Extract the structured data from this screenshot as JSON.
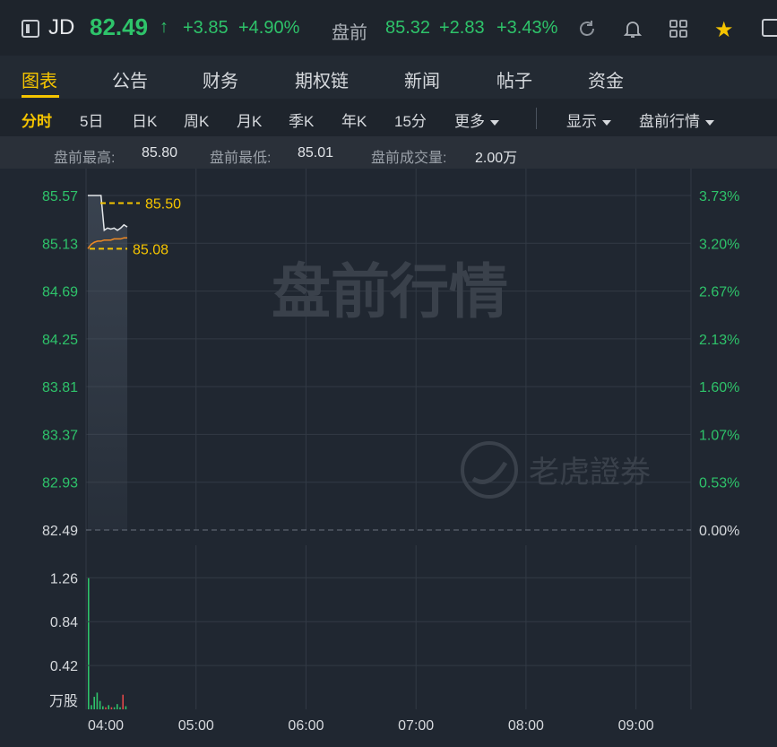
{
  "header": {
    "symbol": "JD",
    "price": "82.49",
    "arrow": "↑",
    "change": "+3.85",
    "change_pct": "+4.90%",
    "premarket_label": "盘前",
    "premarket_price": "85.32",
    "premarket_change": "+2.83",
    "premarket_change_pct": "+3.43%",
    "icons": [
      "refresh-icon",
      "bell-icon",
      "grid-icon",
      "star-icon",
      "window-icon"
    ],
    "colors": {
      "up": "#2ec36a",
      "accent": "#f5c400"
    }
  },
  "tabs": [
    {
      "label": "图表",
      "active": true
    },
    {
      "label": "公告"
    },
    {
      "label": "财务"
    },
    {
      "label": "期权链"
    },
    {
      "label": "新闻"
    },
    {
      "label": "帖子"
    },
    {
      "label": "资金"
    }
  ],
  "periods": {
    "items": [
      "分时",
      "5日",
      "日K",
      "周K",
      "月K",
      "季K",
      "年K",
      "15分"
    ],
    "active": "分时",
    "more": "更多",
    "display": "显示",
    "session": "盘前行情"
  },
  "stats": {
    "high_label": "盘前最高:",
    "high_value": "85.80",
    "low_label": "盘前最低:",
    "low_value": "85.01",
    "volume_label": "盘前成交量:",
    "volume_value": "2.00万"
  },
  "chart_data": {
    "type": "line",
    "watermark": "盘前行情",
    "brand_watermark": "老虎證券",
    "y_left_ticks": [
      "85.57",
      "85.13",
      "84.69",
      "84.25",
      "83.81",
      "83.37",
      "82.93",
      "82.49"
    ],
    "y_right_ticks": [
      "3.73%",
      "3.20%",
      "2.67%",
      "2.13%",
      "1.60%",
      "1.07%",
      "0.53%",
      "0.00%"
    ],
    "x_ticks": [
      "04:00",
      "05:00",
      "06:00",
      "07:00",
      "08:00",
      "09:00"
    ],
    "ylim": [
      82.49,
      85.57
    ],
    "marker_high": "85.50",
    "marker_low": "85.08",
    "price_series": [
      85.57,
      85.57,
      85.57,
      85.57,
      85.57,
      85.25,
      85.27,
      85.26,
      85.27,
      85.25,
      85.27,
      85.3,
      85.28
    ],
    "avg_series": [
      85.08,
      85.12,
      85.14,
      85.15,
      85.15,
      85.16,
      85.16,
      85.16,
      85.17,
      85.17,
      85.17,
      85.18,
      85.18
    ],
    "volume": {
      "unit_label": "万股",
      "ticks": [
        "1.26",
        "0.84",
        "0.42"
      ],
      "ylim": [
        0,
        1.4
      ],
      "values": [
        1.26,
        0.04,
        0.12,
        0.16,
        0.08,
        0.03,
        0.02,
        0.04,
        0.02,
        0.02,
        0.05,
        0.02,
        0.14,
        0.03
      ],
      "colors": [
        "up",
        "up",
        "up",
        "up",
        "up",
        "up",
        "down",
        "up",
        "down",
        "up",
        "up",
        "up",
        "down",
        "up"
      ]
    }
  }
}
